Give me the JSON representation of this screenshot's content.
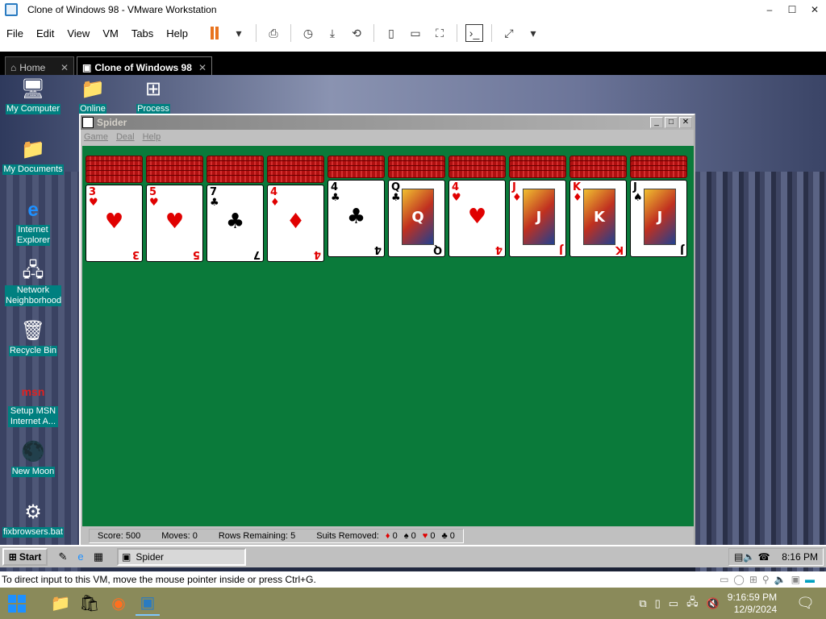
{
  "vmware": {
    "title": "Clone of Windows 98 - VMware Workstation",
    "window_controls": [
      "–",
      "☐",
      "✕"
    ],
    "menu": [
      "File",
      "Edit",
      "View",
      "VM",
      "Tabs",
      "Help"
    ],
    "tabs": [
      {
        "label": "Home",
        "close": "✕"
      },
      {
        "label": "Clone of Windows 98",
        "close": "✕"
      }
    ],
    "status_text": "To direct input to this VM, move the mouse pointer inside or press Ctrl+G."
  },
  "desktop": {
    "icons": [
      {
        "label": "My Computer",
        "icon": "computer-icon"
      },
      {
        "label": "My Documents",
        "icon": "documents-folder-icon"
      },
      {
        "label": "Internet Explorer",
        "icon": "internet-explorer-icon"
      },
      {
        "label": "Network Neighborhood",
        "icon": "network-icon"
      },
      {
        "label": "Recycle Bin",
        "icon": "recycle-bin-icon"
      },
      {
        "label": "Setup MSN Internet A...",
        "icon": "msn-icon"
      },
      {
        "label": "New Moon",
        "icon": "moon-shortcut-icon"
      },
      {
        "label": "fixbrowsers.bat",
        "icon": "batch-file-icon"
      },
      {
        "label": "Online",
        "icon": "folder-icon"
      },
      {
        "label": "Process",
        "icon": "windows-shortcut-icon"
      }
    ]
  },
  "spider": {
    "title": "Spider",
    "menu": [
      "Game",
      "Deal",
      "Help"
    ],
    "columns": [
      {
        "rank": "3",
        "suit": "♥",
        "color": "red"
      },
      {
        "rank": "5",
        "suit": "♥",
        "color": "red"
      },
      {
        "rank": "7",
        "suit": "♣",
        "color": "black"
      },
      {
        "rank": "4",
        "suit": "♦",
        "color": "red"
      },
      {
        "rank": "4",
        "suit": "♣",
        "color": "black"
      },
      {
        "rank": "Q",
        "suit": "♣",
        "color": "black"
      },
      {
        "rank": "4",
        "suit": "♥",
        "color": "red"
      },
      {
        "rank": "J",
        "suit": "♦",
        "color": "red"
      },
      {
        "rank": "K",
        "suit": "♦",
        "color": "red"
      },
      {
        "rank": "J",
        "suit": "♠",
        "color": "black"
      }
    ],
    "status": {
      "score": "Score: 500",
      "moves": "Moves: 0",
      "rows": "Rows Remaining: 5",
      "suits_label": "Suits Removed:",
      "suits": [
        {
          "suit": "♦",
          "count": "0",
          "color": "red"
        },
        {
          "suit": "♠",
          "count": "0",
          "color": "black"
        },
        {
          "suit": "♥",
          "count": "0",
          "color": "red"
        },
        {
          "suit": "♣",
          "count": "0",
          "color": "black"
        }
      ]
    }
  },
  "win98_taskbar": {
    "start": "Start",
    "task": "Spider",
    "clock": "8:16 PM"
  },
  "win11_taskbar": {
    "time": "9:16:59 PM",
    "date": "12/9/2024"
  }
}
